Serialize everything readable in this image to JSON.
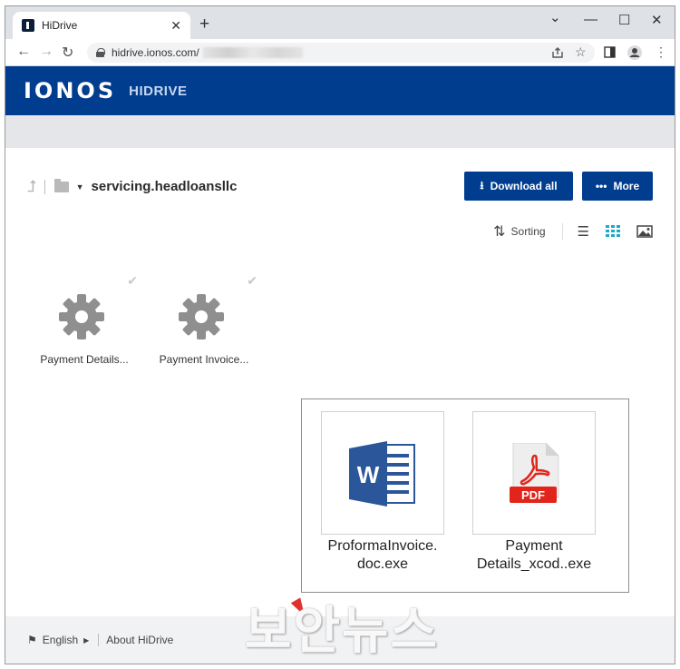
{
  "browser": {
    "tab_title": "HiDrive",
    "tab_close": "✕",
    "new_tab": "+",
    "url": "hidrive.ionos.com/",
    "controls": {
      "minimize": "—",
      "maximize": "☐",
      "close": "✕",
      "dropdown": "⌄"
    }
  },
  "header": {
    "logo": "IONOS",
    "product": "HIDRIVE",
    "brand_color": "#003d8f"
  },
  "breadcrumb": {
    "folder_name": "servicing.headloansllc"
  },
  "actions": {
    "download_all": "Download all",
    "more": "More"
  },
  "view": {
    "sorting_label": "Sorting",
    "active_view": "grid",
    "active_color": "#1aa9c9"
  },
  "files": [
    {
      "name": "Payment Details...",
      "icon": "gear-icon",
      "checked": true
    },
    {
      "name": "Payment Invoice...",
      "icon": "gear-icon",
      "checked": true
    }
  ],
  "overlay_docs": [
    {
      "name_line1": "ProformaInvoice.",
      "name_line2": "doc.exe",
      "icon": "word-icon"
    },
    {
      "name_line1": "Payment",
      "name_line2": "Details_xcod..exe",
      "icon": "pdf-icon",
      "badge": "PDF"
    }
  ],
  "footer": {
    "language": "English",
    "about": "About HiDrive"
  },
  "watermark": "보안뉴스"
}
